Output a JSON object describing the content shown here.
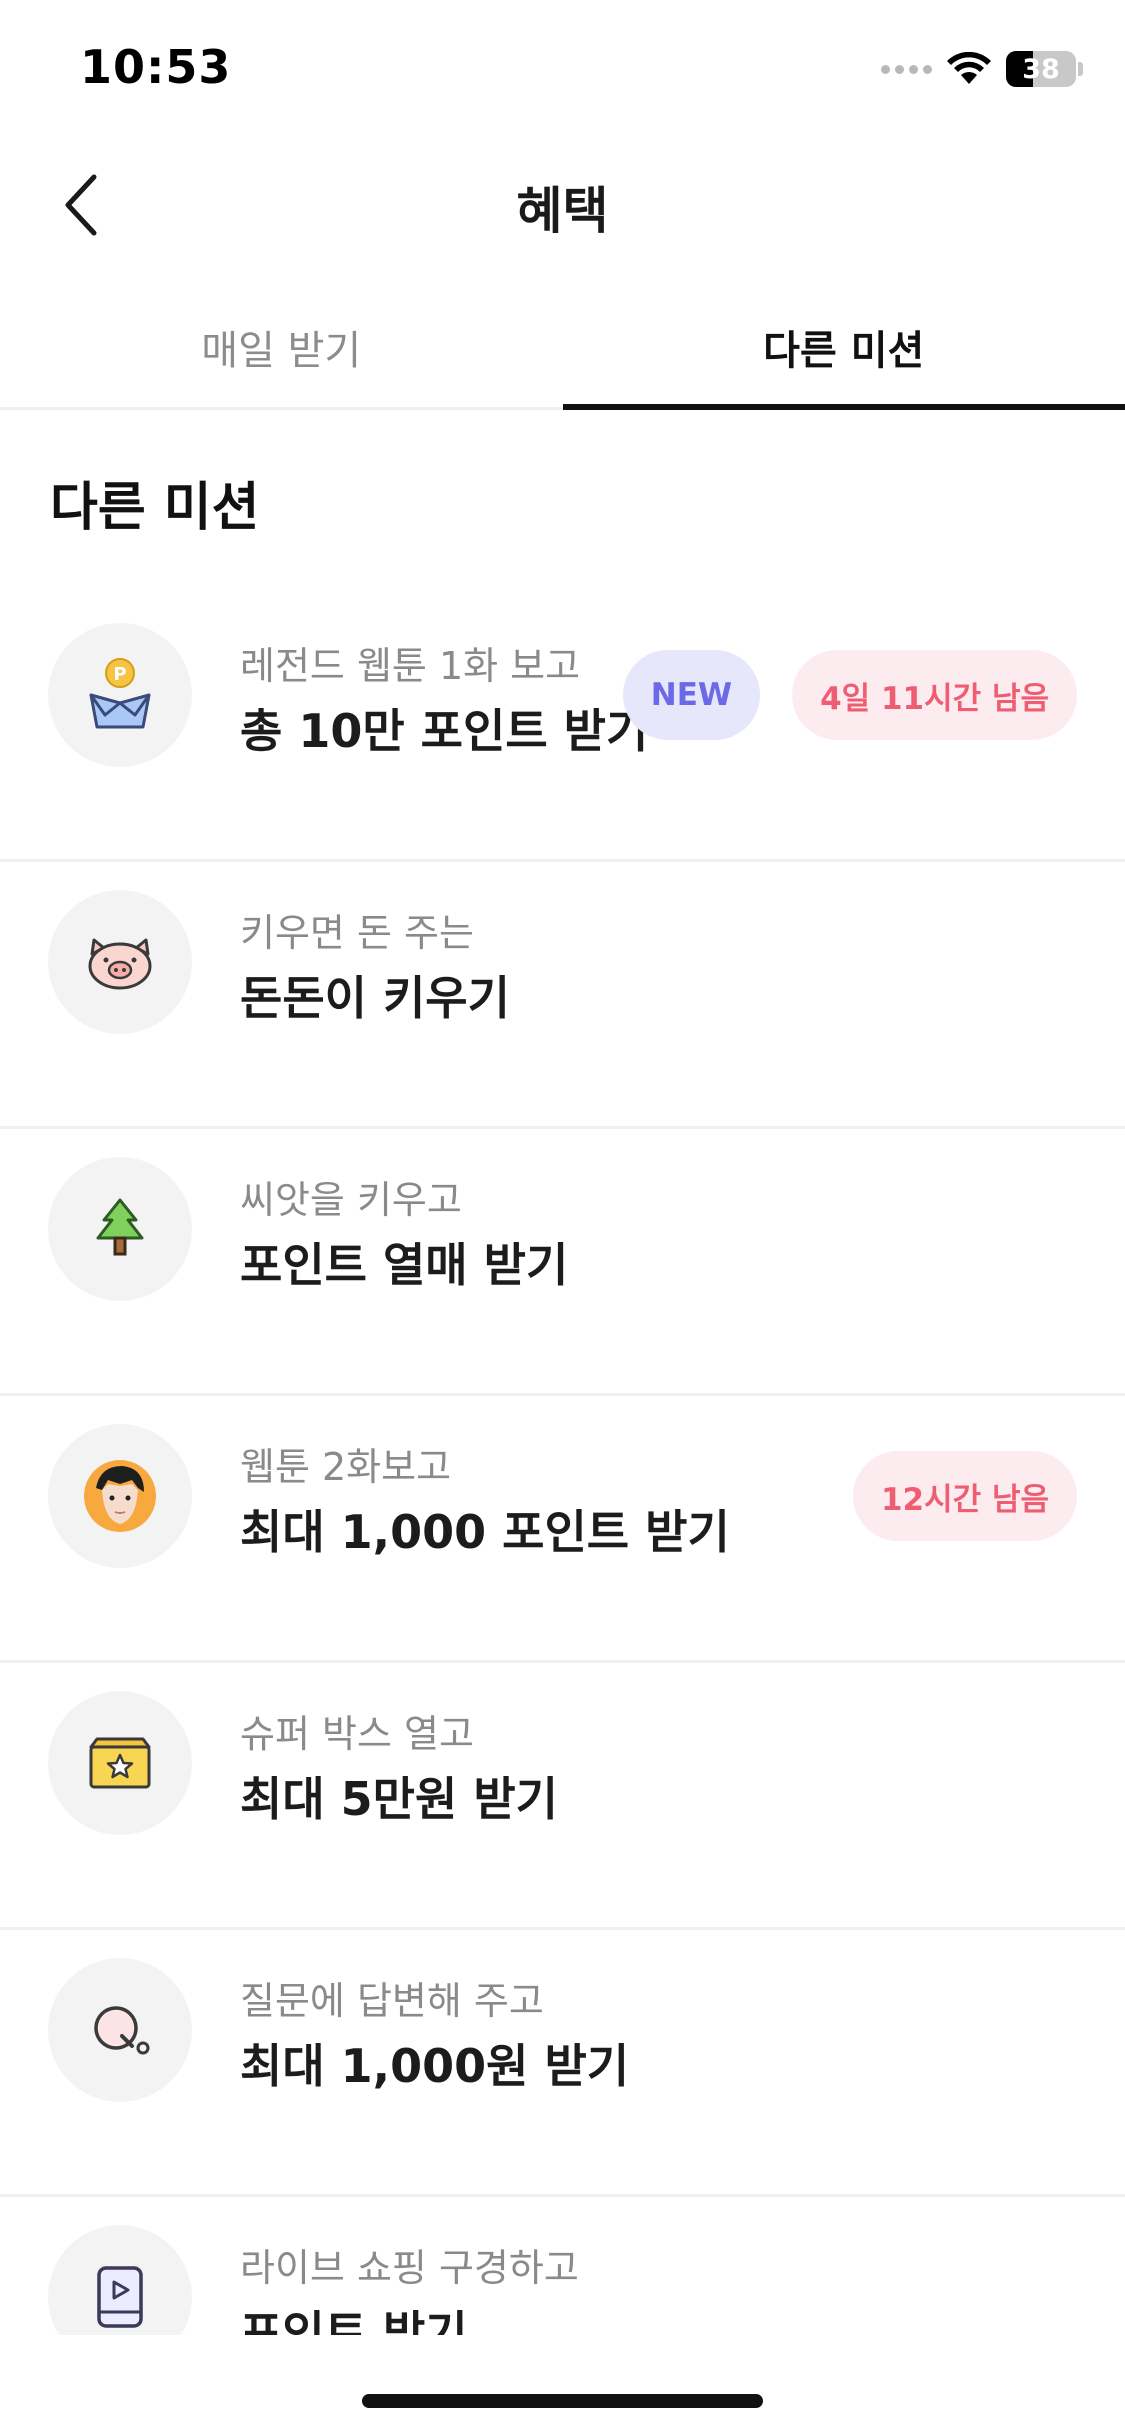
{
  "status_bar": {
    "time": "10:53",
    "battery": "38"
  },
  "header": {
    "title": "혜택",
    "back_icon": "chevron-left-icon"
  },
  "tabs": [
    {
      "label": "매일 받기",
      "active": false
    },
    {
      "label": "다른 미션",
      "active": true
    }
  ],
  "section": {
    "title": "다른 미션"
  },
  "missions": [
    {
      "icon": "gift-box-point-icon",
      "subtitle": "레전드 웹툰 1화 보고",
      "title": "총 10만 포인트 받기",
      "badge_new": "NEW",
      "badge_time": "4일 11시간 남음"
    },
    {
      "icon": "pig-icon",
      "subtitle": "키우면 돈 주는",
      "title": "돈돈이 키우기"
    },
    {
      "icon": "tree-icon",
      "subtitle": "씨앗을 키우고",
      "title": "포인트 열매 받기"
    },
    {
      "icon": "webtoon-character-icon",
      "subtitle": "웹툰 2화보고",
      "title": "최대 1,000 포인트 받기",
      "badge_time": "12시간 남음"
    },
    {
      "icon": "star-box-icon",
      "subtitle": "슈퍼 박스 열고",
      "title": "최대 5만원 받기"
    },
    {
      "icon": "question-q-icon",
      "subtitle": "질문에 답변해 주고",
      "title": "최대 1,000원 받기"
    },
    {
      "icon": "mobile-play-icon",
      "subtitle": "라이브 쇼핑 구경하고",
      "title": "포인트 받기"
    }
  ]
}
